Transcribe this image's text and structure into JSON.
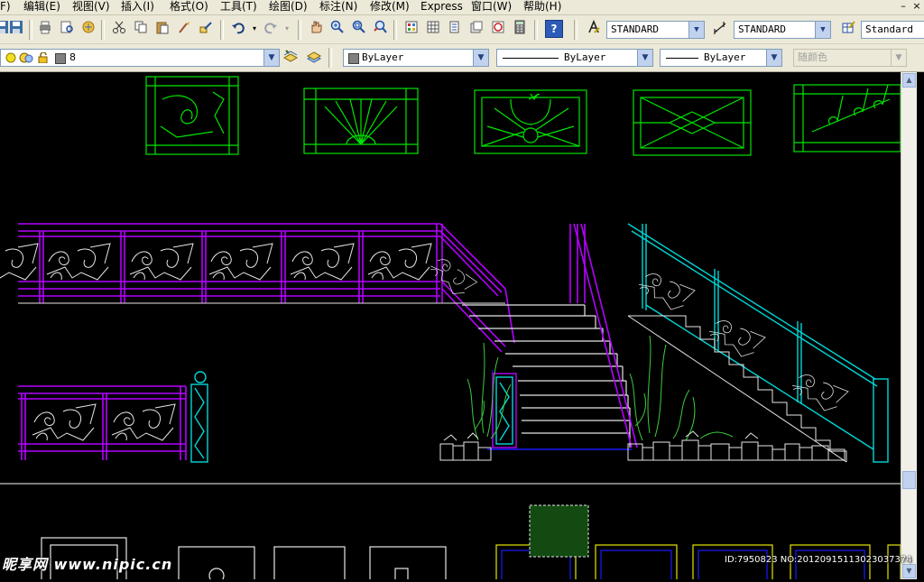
{
  "menu": {
    "items": [
      "F)",
      "编辑(E)",
      "视图(V)",
      "插入(I)",
      "格式(O)",
      "工具(T)",
      "绘图(D)",
      "标注(N)",
      "修改(M)",
      "Express",
      "窗口(W)",
      "帮助(H)"
    ],
    "close_glyph": "×"
  },
  "toolbar": {
    "text_style": "STANDARD",
    "dim_style": "STANDARD",
    "table_style": "Standard",
    "help_glyph": "?"
  },
  "properties_bar": {
    "layer_name": "8",
    "color": "ByLayer",
    "linetype": "ByLayer",
    "lineweight": "ByLayer",
    "plot_style": "随颜色"
  },
  "watermark": {
    "left": "昵享网 www.nipic.cn",
    "right": "ID:7950823 NO:20120915113023037374"
  },
  "colors": {
    "railing_magenta": "#b400ff",
    "pattern_white": "#e6e6e6",
    "frame_green": "#00e600",
    "stair_cyan": "#00d8d8",
    "plant_green": "#3ccc3c",
    "bottom_yellow": "#e6e600",
    "bottom_blue": "#1a1aff",
    "selection_fill": "#124a12"
  }
}
